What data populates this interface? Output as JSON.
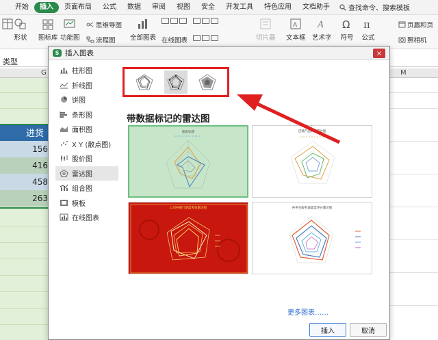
{
  "menubar": {
    "tabs": [
      "开始",
      "插入",
      "页面布局",
      "公式",
      "数据",
      "审阅",
      "视图",
      "安全",
      "开发工具",
      "特色应用",
      "文档助手"
    ],
    "active_tab": "插入",
    "search_label": "查找命令、搜索模板"
  },
  "ribbon": {
    "shapes": "形状",
    "icon_lib": "图标库",
    "func_chart": "功能图",
    "mind_map": "思维导图",
    "flow_chart": "流程图",
    "all_charts": "全部图表",
    "online_charts": "在线图表",
    "slicer": "切片器",
    "textbox": "文本框",
    "art_text": "艺术字",
    "symbol": "符号",
    "formula": "公式",
    "header_footer": "页眉和页",
    "camera": "照相机"
  },
  "sheet": {
    "cell_ref": "类型",
    "col_g": "G",
    "col_m": "M",
    "header_cell": "进货",
    "values": [
      "156",
      "416",
      "458",
      "263"
    ]
  },
  "dialog": {
    "title": "插入图表",
    "close": "×",
    "categories": [
      {
        "label": "柱形图",
        "icon": "column-chart-icon"
      },
      {
        "label": "折线图",
        "icon": "line-chart-icon"
      },
      {
        "label": "饼图",
        "icon": "pie-chart-icon"
      },
      {
        "label": "条形图",
        "icon": "bar-chart-icon"
      },
      {
        "label": "面积图",
        "icon": "area-chart-icon"
      },
      {
        "label": "X Y (散点图)",
        "icon": "scatter-chart-icon"
      },
      {
        "label": "股价图",
        "icon": "stock-chart-icon"
      },
      {
        "label": "雷达图",
        "icon": "radar-chart-icon"
      },
      {
        "label": "组合图",
        "icon": "combo-chart-icon"
      },
      {
        "label": "模板",
        "icon": "template-icon"
      },
      {
        "label": "在线图表",
        "icon": "online-chart-icon"
      }
    ],
    "selected_category": "雷达图",
    "subtype_title": "带数据标记的雷达图",
    "thumb_captions": [
      "图表标题",
      "店铺产品销量雷达图",
      "公司各部门季度考核雷达图",
      "各平台服务满意度评分雷达图"
    ],
    "more_link": "更多图表……",
    "insert_button": "插入",
    "cancel_button": "取消"
  },
  "colors": {
    "accent_green": "#2a8a4a",
    "annotation_red": "#e02020",
    "link_blue": "#2f6fd1"
  }
}
